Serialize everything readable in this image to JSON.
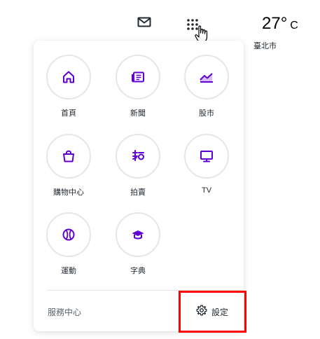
{
  "weather": {
    "temperature": "27°",
    "unit": "C",
    "city": "臺北市"
  },
  "menu": {
    "items": [
      {
        "label": "首頁",
        "icon": "home-icon"
      },
      {
        "label": "新聞",
        "icon": "news-icon"
      },
      {
        "label": "股市",
        "icon": "finance-chart-icon"
      },
      {
        "label": "購物中心",
        "icon": "shopping-bag-icon"
      },
      {
        "label": "拍賣",
        "icon": "auction-icon"
      },
      {
        "label": "TV",
        "icon": "tv-icon"
      },
      {
        "label": "運動",
        "icon": "baseball-icon"
      },
      {
        "label": "字典",
        "icon": "graduation-cap-icon"
      }
    ],
    "help_label": "服務中心",
    "settings_label": "設定"
  },
  "colors": {
    "accent": "#6001d2",
    "circle_border": "#e6e6ea",
    "highlight": "#ff0000"
  }
}
